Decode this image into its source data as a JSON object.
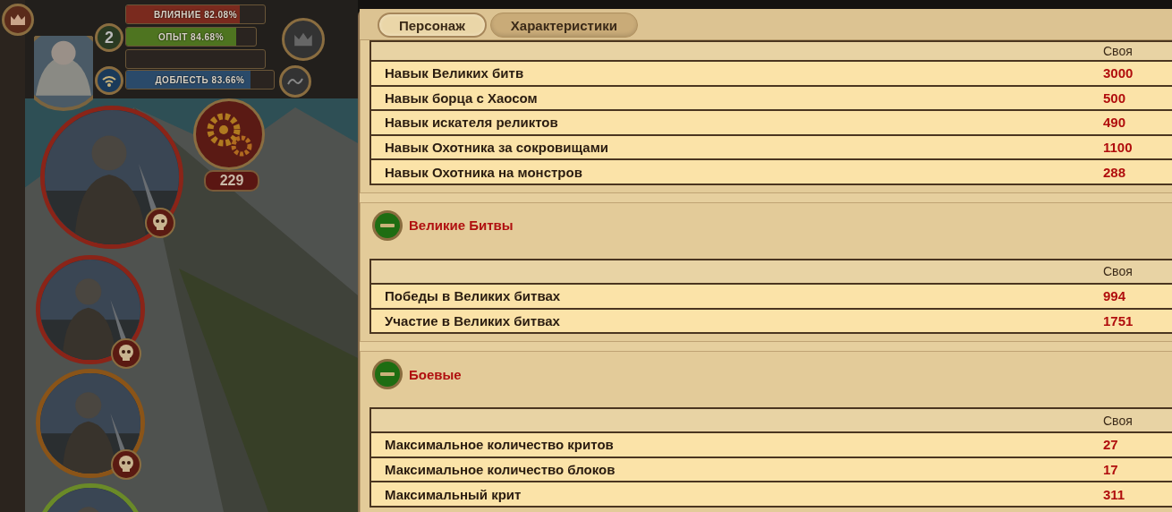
{
  "hud": {
    "bars": [
      {
        "kind": "influence",
        "label": "ВЛИЯНИЕ 82.08%",
        "level": 0.82
      },
      {
        "kind": "experience",
        "label": "ОПЫТ 84.68%",
        "level": 0.85
      },
      {
        "kind": "valor",
        "label": "ДОБЛЕСТЬ 83.66%",
        "level": 0.84
      }
    ],
    "player_level": "2",
    "counter": "229"
  },
  "heroes": [
    {
      "color": "#8a2418"
    },
    {
      "color": "#8a2418"
    },
    {
      "color": "#8a5418"
    },
    {
      "color": "#6a8a28"
    }
  ],
  "tabs": [
    {
      "label": "Персонаж",
      "selected": true
    },
    {
      "label": "Характеристики",
      "selected": false
    }
  ],
  "sections": [
    {
      "column": "Своя",
      "rows": [
        {
          "name": "Навык Великих битв",
          "value": "3000"
        },
        {
          "name": "Навык борца с Хаосом",
          "value": "500"
        },
        {
          "name": "Навык искателя реликтов",
          "value": "490"
        },
        {
          "name": "Навык Охотника за сокровищами",
          "value": "1100"
        },
        {
          "name": "Навык Охотника на монстров",
          "value": "288"
        }
      ]
    },
    {
      "title": "Великие Битвы",
      "expanded": true,
      "column": "Своя",
      "rows": [
        {
          "name": "Победы в Великих битвах",
          "value": "994"
        },
        {
          "name": "Участие в Великих битвах",
          "value": "1751"
        }
      ]
    },
    {
      "title": "Боевые",
      "expanded": true,
      "column": "Своя",
      "rows": [
        {
          "name": "Максимальное количество критов",
          "value": "27"
        },
        {
          "name": "Максимальное количество блоков",
          "value": "17"
        },
        {
          "name": "Максимальный крит",
          "value": "311"
        }
      ]
    }
  ]
}
